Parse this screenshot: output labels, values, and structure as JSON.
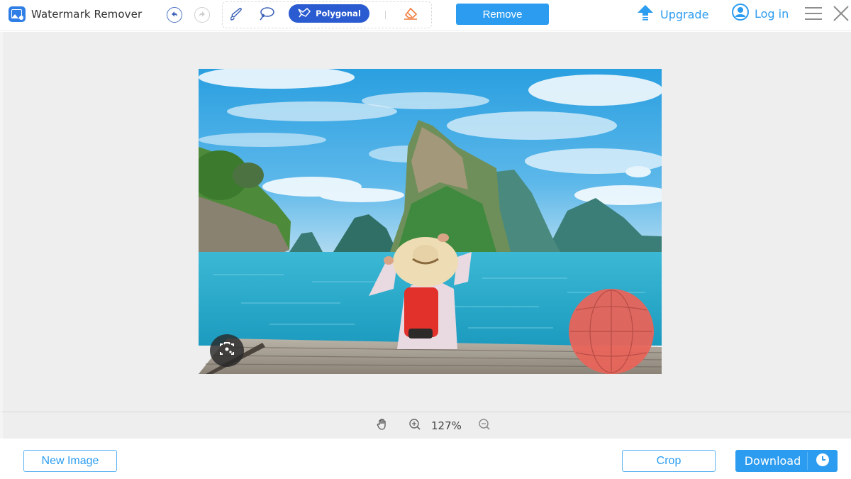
{
  "app": {
    "title": "Watermark Remover",
    "logo_icon": "image-app-icon"
  },
  "toolbar": {
    "undo_icon": "undo-icon",
    "redo_icon": "redo-icon",
    "tools": [
      {
        "name": "brush",
        "icon": "brush-icon"
      },
      {
        "name": "lasso",
        "icon": "lasso-icon"
      },
      {
        "name": "polygonal",
        "icon": "polygon-lasso-icon",
        "label": "Polygonal",
        "active": true
      },
      {
        "name": "eraser",
        "icon": "eraser-icon"
      }
    ],
    "remove_label": "Remove",
    "upgrade_label": "Upgrade",
    "login_label": "Log in",
    "menu_icon": "hamburger-menu-icon",
    "close_icon": "close-icon"
  },
  "canvas": {
    "image_description": "Woman in straw hat with red backpack sitting on wooden pier facing turquoise sea and limestone islands",
    "selection_mask_color": "#e8645a",
    "scan_icon": "screenshot-scan-icon"
  },
  "zoom_bar": {
    "hand_icon": "hand-pan-icon",
    "zoom_in_icon": "zoom-in-icon",
    "zoom_level": "127%",
    "zoom_out_icon": "zoom-out-icon"
  },
  "footer": {
    "new_image_label": "New Image",
    "crop_label": "Crop",
    "download_label": "Download",
    "history_icon": "clock-icon"
  },
  "colors": {
    "accent": "#2b9cf0",
    "polygon_active": "#2a5bd0",
    "eraser": "#f07a3a",
    "canvas_bg": "#eeeeee"
  }
}
